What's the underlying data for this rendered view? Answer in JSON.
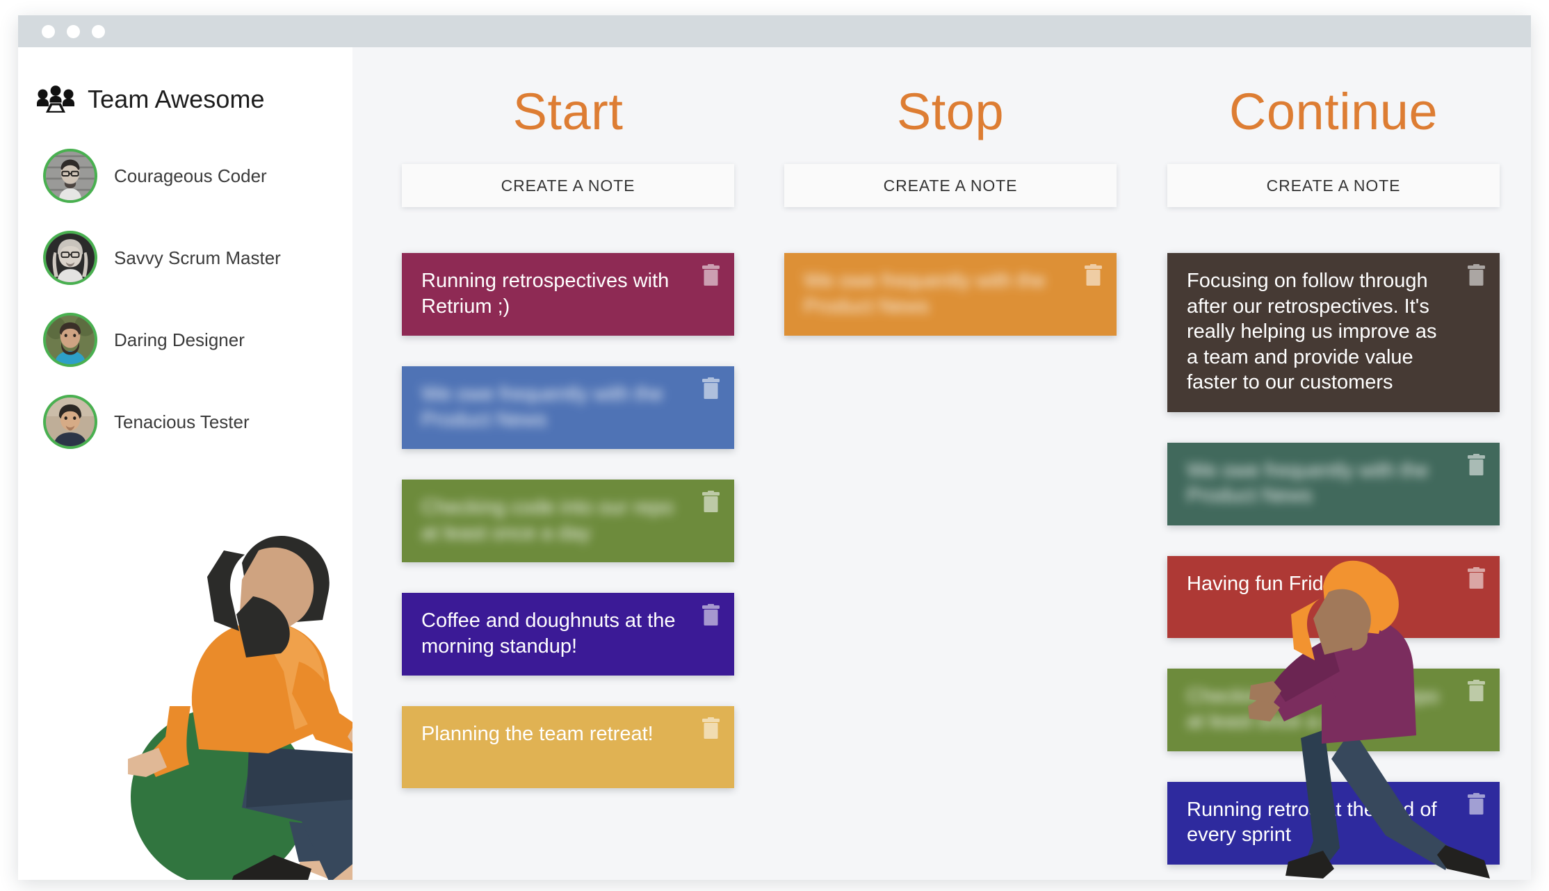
{
  "window": {
    "traffic_lights": [
      "close",
      "minimize",
      "maximize"
    ]
  },
  "sidebar": {
    "team_icon": "team-group-icon",
    "team_name": "Team Awesome",
    "members": [
      {
        "name": "Courageous Coder",
        "avatar": "avatar-courageous-coder",
        "status_color": "#49b050"
      },
      {
        "name": "Savvy Scrum Master",
        "avatar": "avatar-savvy-scrum-master",
        "status_color": "#49b050"
      },
      {
        "name": "Daring Designer",
        "avatar": "avatar-daring-designer",
        "status_color": "#49b050"
      },
      {
        "name": "Tenacious Tester",
        "avatar": "avatar-tenacious-tester",
        "status_color": "#49b050"
      }
    ]
  },
  "board": {
    "accent_color": "#dd7d33",
    "columns": [
      {
        "title": "Start",
        "create_label": "CREATE A NOTE",
        "notes": [
          {
            "text": "Running retrospectives with Retrium ;)",
            "color": "#8e2a54",
            "blurred": false,
            "delete_icon": "trash-icon"
          },
          {
            "text": "We owe frequently with the Product News",
            "color": "#4f73b5",
            "blurred": true,
            "delete_icon": "trash-icon"
          },
          {
            "text": "Checking code into our repo at least once a day",
            "color": "#6d8b3c",
            "blurred": true,
            "delete_icon": "trash-icon"
          },
          {
            "text": "Coffee and doughnuts at the morning standup!",
            "color": "#3b1a96",
            "blurred": false,
            "delete_icon": "trash-icon"
          },
          {
            "text": "Planning the team retreat!",
            "color": "#e0b253",
            "blurred": false,
            "delete_icon": "trash-icon"
          }
        ]
      },
      {
        "title": "Stop",
        "create_label": "CREATE A NOTE",
        "notes": [
          {
            "text": "We owe frequently with the Product News",
            "color": "#dd9036",
            "blurred": true,
            "delete_icon": "trash-icon"
          }
        ]
      },
      {
        "title": "Continue",
        "create_label": "CREATE A NOTE",
        "notes": [
          {
            "text": "Focusing on follow through after our retrospectives. It's really helping us improve as a team and provide value faster to our customers",
            "color": "#463a34",
            "blurred": false,
            "delete_icon": "trash-icon"
          },
          {
            "text": "We owe frequently with the Product News",
            "color": "#41695c",
            "blurred": true,
            "delete_icon": "trash-icon"
          },
          {
            "text": "Having fun Friday",
            "color": "#ae3935",
            "blurred": false,
            "delete_icon": "trash-icon"
          },
          {
            "text": "Checking code into our repo at least once a day",
            "color": "#6d8b3c",
            "blurred": true,
            "delete_icon": "trash-icon"
          },
          {
            "text": "Running retros at the end of every sprint",
            "color": "#2e2a9e",
            "blurred": false,
            "delete_icon": "trash-icon"
          }
        ]
      }
    ]
  },
  "illustrations": [
    {
      "name": "sitting-person-illustration",
      "description": "bearded person in orange jacket sitting on a green exercise ball"
    },
    {
      "name": "walking-person-illustration",
      "description": "person with orange hair in purple sweater walking"
    }
  ]
}
